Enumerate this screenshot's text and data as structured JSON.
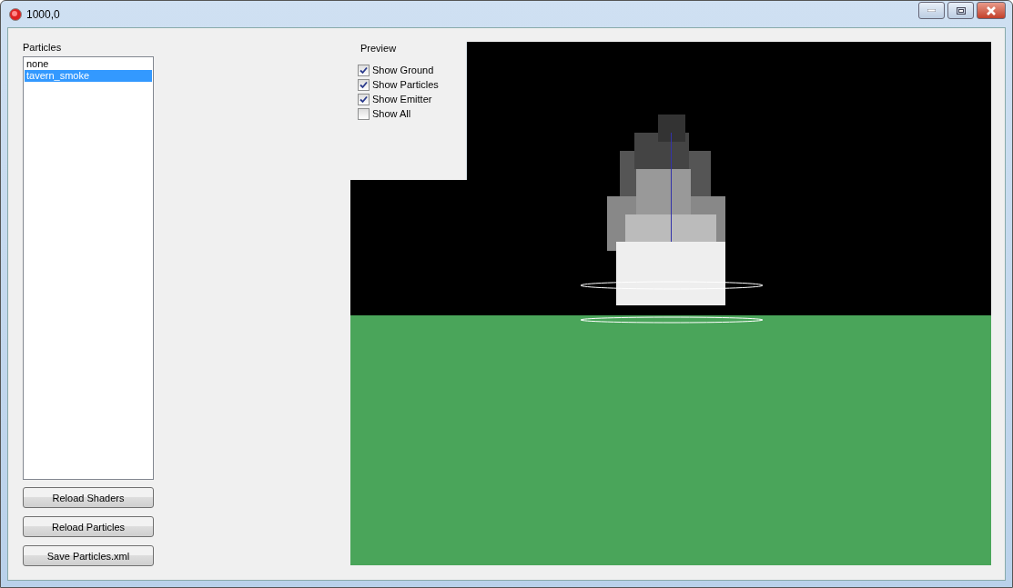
{
  "window": {
    "title": "1000,0"
  },
  "particles": {
    "label": "Particles",
    "items": [
      {
        "label": "none",
        "selected": false
      },
      {
        "label": "tavern_smoke",
        "selected": true
      }
    ]
  },
  "buttons": [
    "Reload Shaders",
    "Reload Particles",
    "Save Particles.xml"
  ],
  "preview": {
    "title": "Preview",
    "options": [
      {
        "label": "Show Ground",
        "checked": true
      },
      {
        "label": "Show Particles",
        "checked": true
      },
      {
        "label": "Show Emitter",
        "checked": true
      },
      {
        "label": "Show All",
        "checked": false
      }
    ]
  }
}
